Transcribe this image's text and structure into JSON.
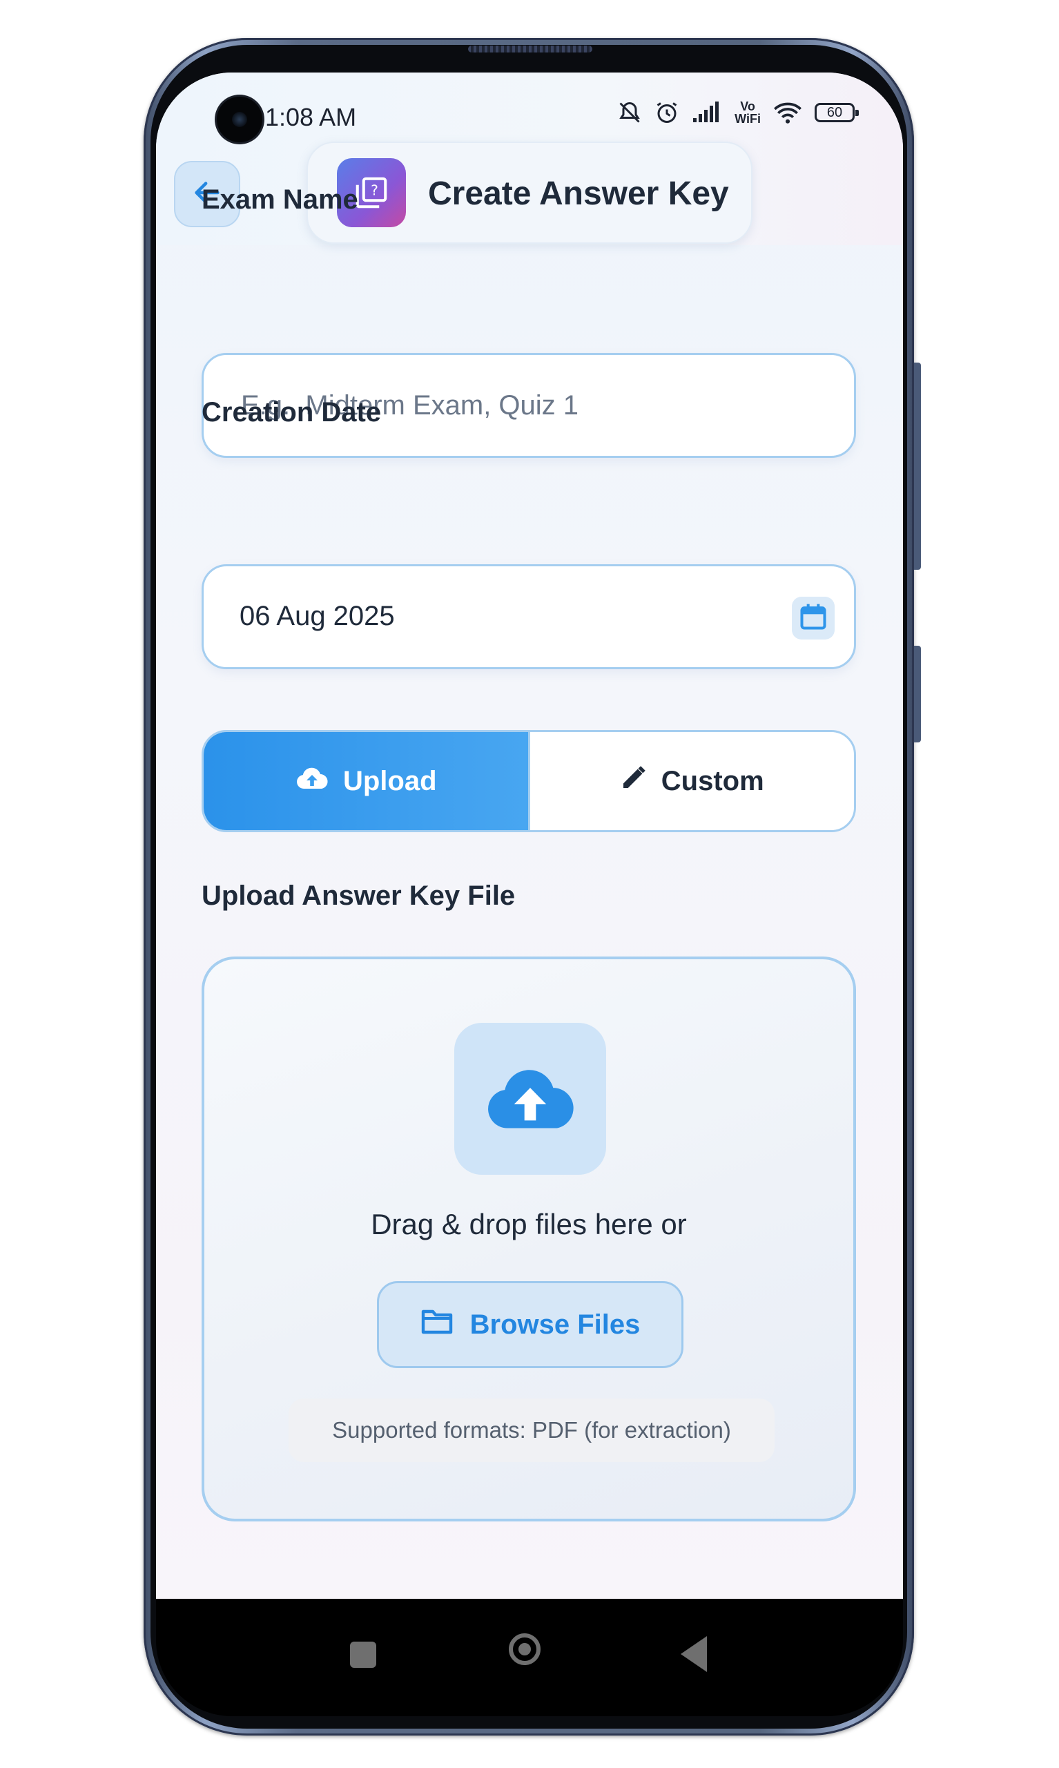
{
  "status_bar": {
    "time": "1:08 AM",
    "battery": "60",
    "vowifi_line1": "Vo",
    "vowifi_line2": "WiFi"
  },
  "header": {
    "title": "Create Answer Key",
    "back_icon": "arrow-left-icon",
    "title_icon": "quiz-icon"
  },
  "form": {
    "exam_name": {
      "label": "Exam Name",
      "placeholder": "E.g., Midterm Exam, Quiz 1",
      "value": ""
    },
    "creation_date": {
      "label": "Creation Date",
      "value": "06 Aug 2025",
      "icon": "calendar-icon"
    }
  },
  "mode_toggle": {
    "selected": "Upload",
    "options": [
      {
        "label": "Upload",
        "icon": "cloud-upload-icon"
      },
      {
        "label": "Custom",
        "icon": "pencil-icon"
      }
    ]
  },
  "upload": {
    "section_label": "Upload Answer Key File",
    "drag_text": "Drag & drop files here or",
    "browse_label": "Browse Files",
    "formats_note": "Supported formats: PDF (for extraction)"
  },
  "colors": {
    "accent": "#2b92ea",
    "border": "#a5cef0",
    "text": "#1f2a3a"
  }
}
